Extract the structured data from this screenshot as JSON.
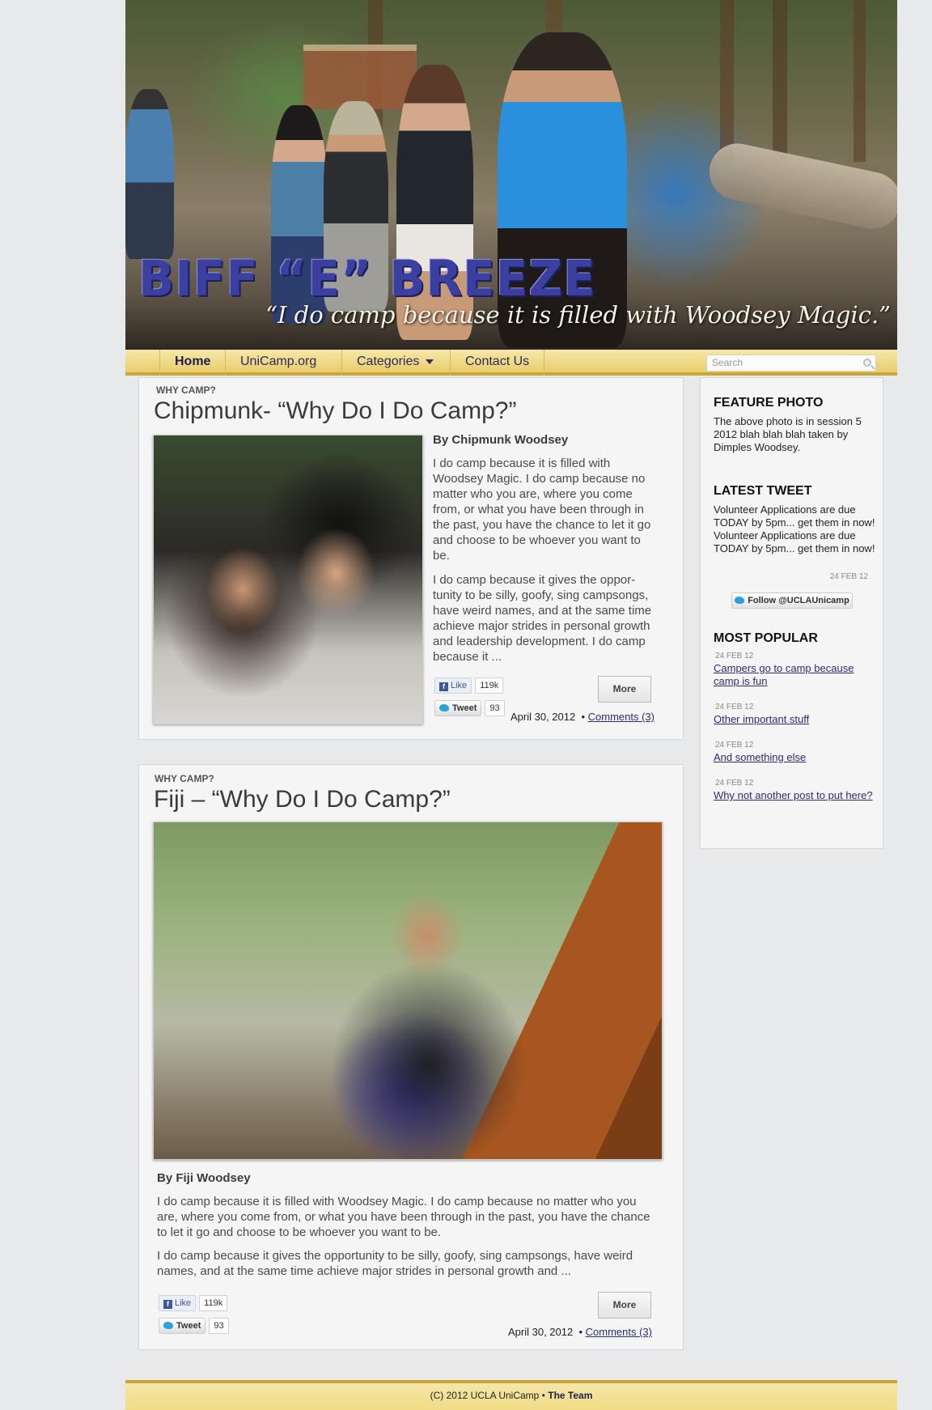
{
  "banner": {
    "name": "BIFF “E” BREEZE",
    "quote": "“I do camp because it is filled with Woodsey Magic.”"
  },
  "nav": {
    "items": [
      "Home",
      "UniCamp.org",
      "Categories",
      "Contact Us"
    ],
    "active": "Home",
    "search_placeholder": "Search"
  },
  "posts": [
    {
      "category": "WHY CAMP?",
      "title": "Chipmunk- “Why Do I Do Camp?”",
      "byline": "By Chipmunk Woodsey",
      "paragraphs": [
        "I do camp because it is filled with Woodsey Magic. I do camp because no matter who you are, where you come from, or what you have been through in the past, you have the chance to let it go and choose to be whoever you want to be.",
        "I do camp because it gives the oppor­tunity to be silly, goofy, sing camp­songs, have weird names, and at the same time achieve major strides in personal growth and leadership devel­opment. I do camp because it ..."
      ],
      "like_label": "Like",
      "like_count": "119k",
      "tweet_label": "Tweet",
      "tweet_count": "93",
      "more_label": "More",
      "date": "April 30, 2012",
      "comments": "Comments (3)"
    },
    {
      "category": "WHY CAMP?",
      "title": "Fiji – “Why Do I Do Camp?”",
      "byline": "By Fiji Woodsey",
      "paragraphs": [
        "I do camp because it is filled with Woodsey Magic. I do camp because no matter who you are, where you come from, or what you have been through in the past, you have the chance to let it go and choose to be whoever you want to be.",
        "I do camp because it gives the opportunity to be silly, goofy, sing campsongs, have weird names, and at the same time achieve major strides in personal growth and ..."
      ],
      "like_label": "Like",
      "like_count": "119k",
      "tweet_label": "Tweet",
      "tweet_count": "93",
      "more_label": "More",
      "date": "April 30, 2012",
      "comments": "Comments (3)"
    }
  ],
  "sidebar": {
    "feature_heading": "FEATURE PHOTO",
    "feature_text": "The above photo is in session 5 2012 blah blah blah taken by Dimples Woodsey.",
    "tweet_heading": "LATEST TWEET",
    "tweet_text": "Volunteer Applications are due TODAY by 5pm... get them in now! Volunteer Applications are due TODAY by 5pm... get them in now!",
    "tweet_date": "24 FEB 12",
    "follow_label": "Follow @UCLAUnicamp",
    "popular_heading": "MOST POPULAR",
    "popular": [
      {
        "date": "24 FEB 12",
        "title": "Campers go to camp because camp is fun"
      },
      {
        "date": "24 FEB 12",
        "title": "Other important stuff"
      },
      {
        "date": "24 FEB 12",
        "title": "And something else"
      },
      {
        "date": "24 FEB 12",
        "title": "Why not another post to put here?"
      }
    ]
  },
  "footer": {
    "copyright": "(C) 2012 UCLA UniCamp •",
    "team": "The Team"
  }
}
